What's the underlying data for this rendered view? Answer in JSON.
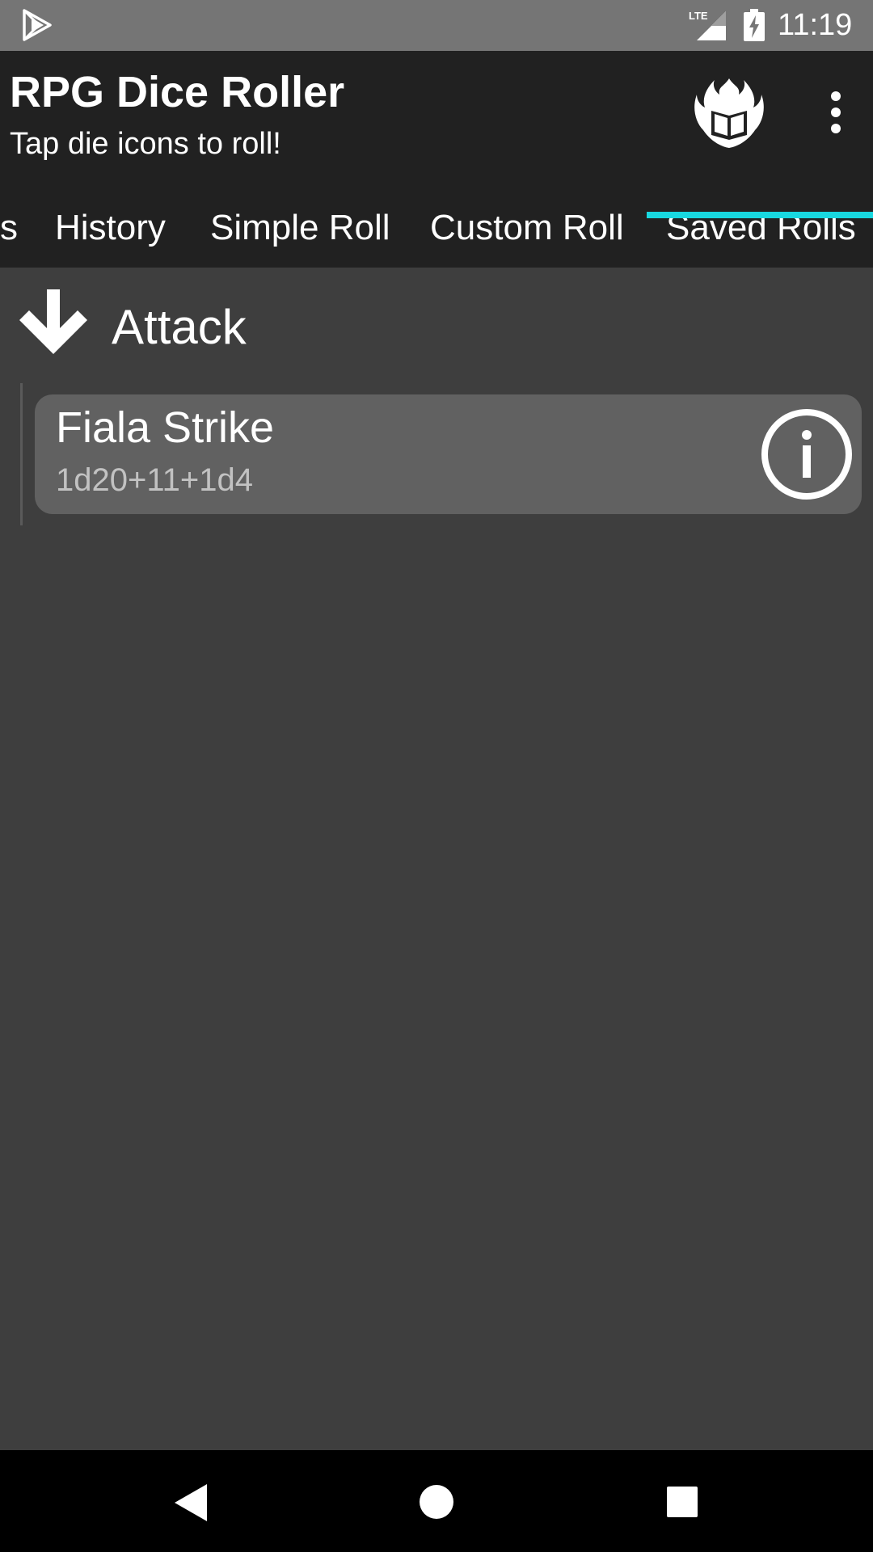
{
  "status_bar": {
    "time": "11:19",
    "network_label": "LTE",
    "icons": [
      "play-store-icon",
      "lte-signal-icon",
      "battery-charging-icon"
    ]
  },
  "app_bar": {
    "title": "RPG Dice Roller",
    "subtitle": "Tap die icons to roll!",
    "icons": [
      "flaming-book-logo-icon",
      "overflow-menu-icon"
    ]
  },
  "tabs": {
    "items": [
      {
        "label": "s"
      },
      {
        "label": "History"
      },
      {
        "label": "Simple Roll"
      },
      {
        "label": "Custom Roll"
      },
      {
        "label": "Saved Rolls"
      }
    ],
    "selected": "Saved Rolls"
  },
  "saved_rolls": {
    "groups": [
      {
        "name": "Attack",
        "expanded": true,
        "rolls": [
          {
            "name": "Fiala Strike",
            "formula": "1d20+11+1d4"
          }
        ]
      }
    ]
  },
  "nav_bar": {
    "icons": [
      "back-icon",
      "home-icon",
      "recents-icon"
    ]
  },
  "colors": {
    "status_bar": "#757575",
    "app_bar": "#212121",
    "background": "#3e3e3e",
    "card": "#616161",
    "tab_indicator": "#18d8e0",
    "nav_bar": "#000000"
  }
}
